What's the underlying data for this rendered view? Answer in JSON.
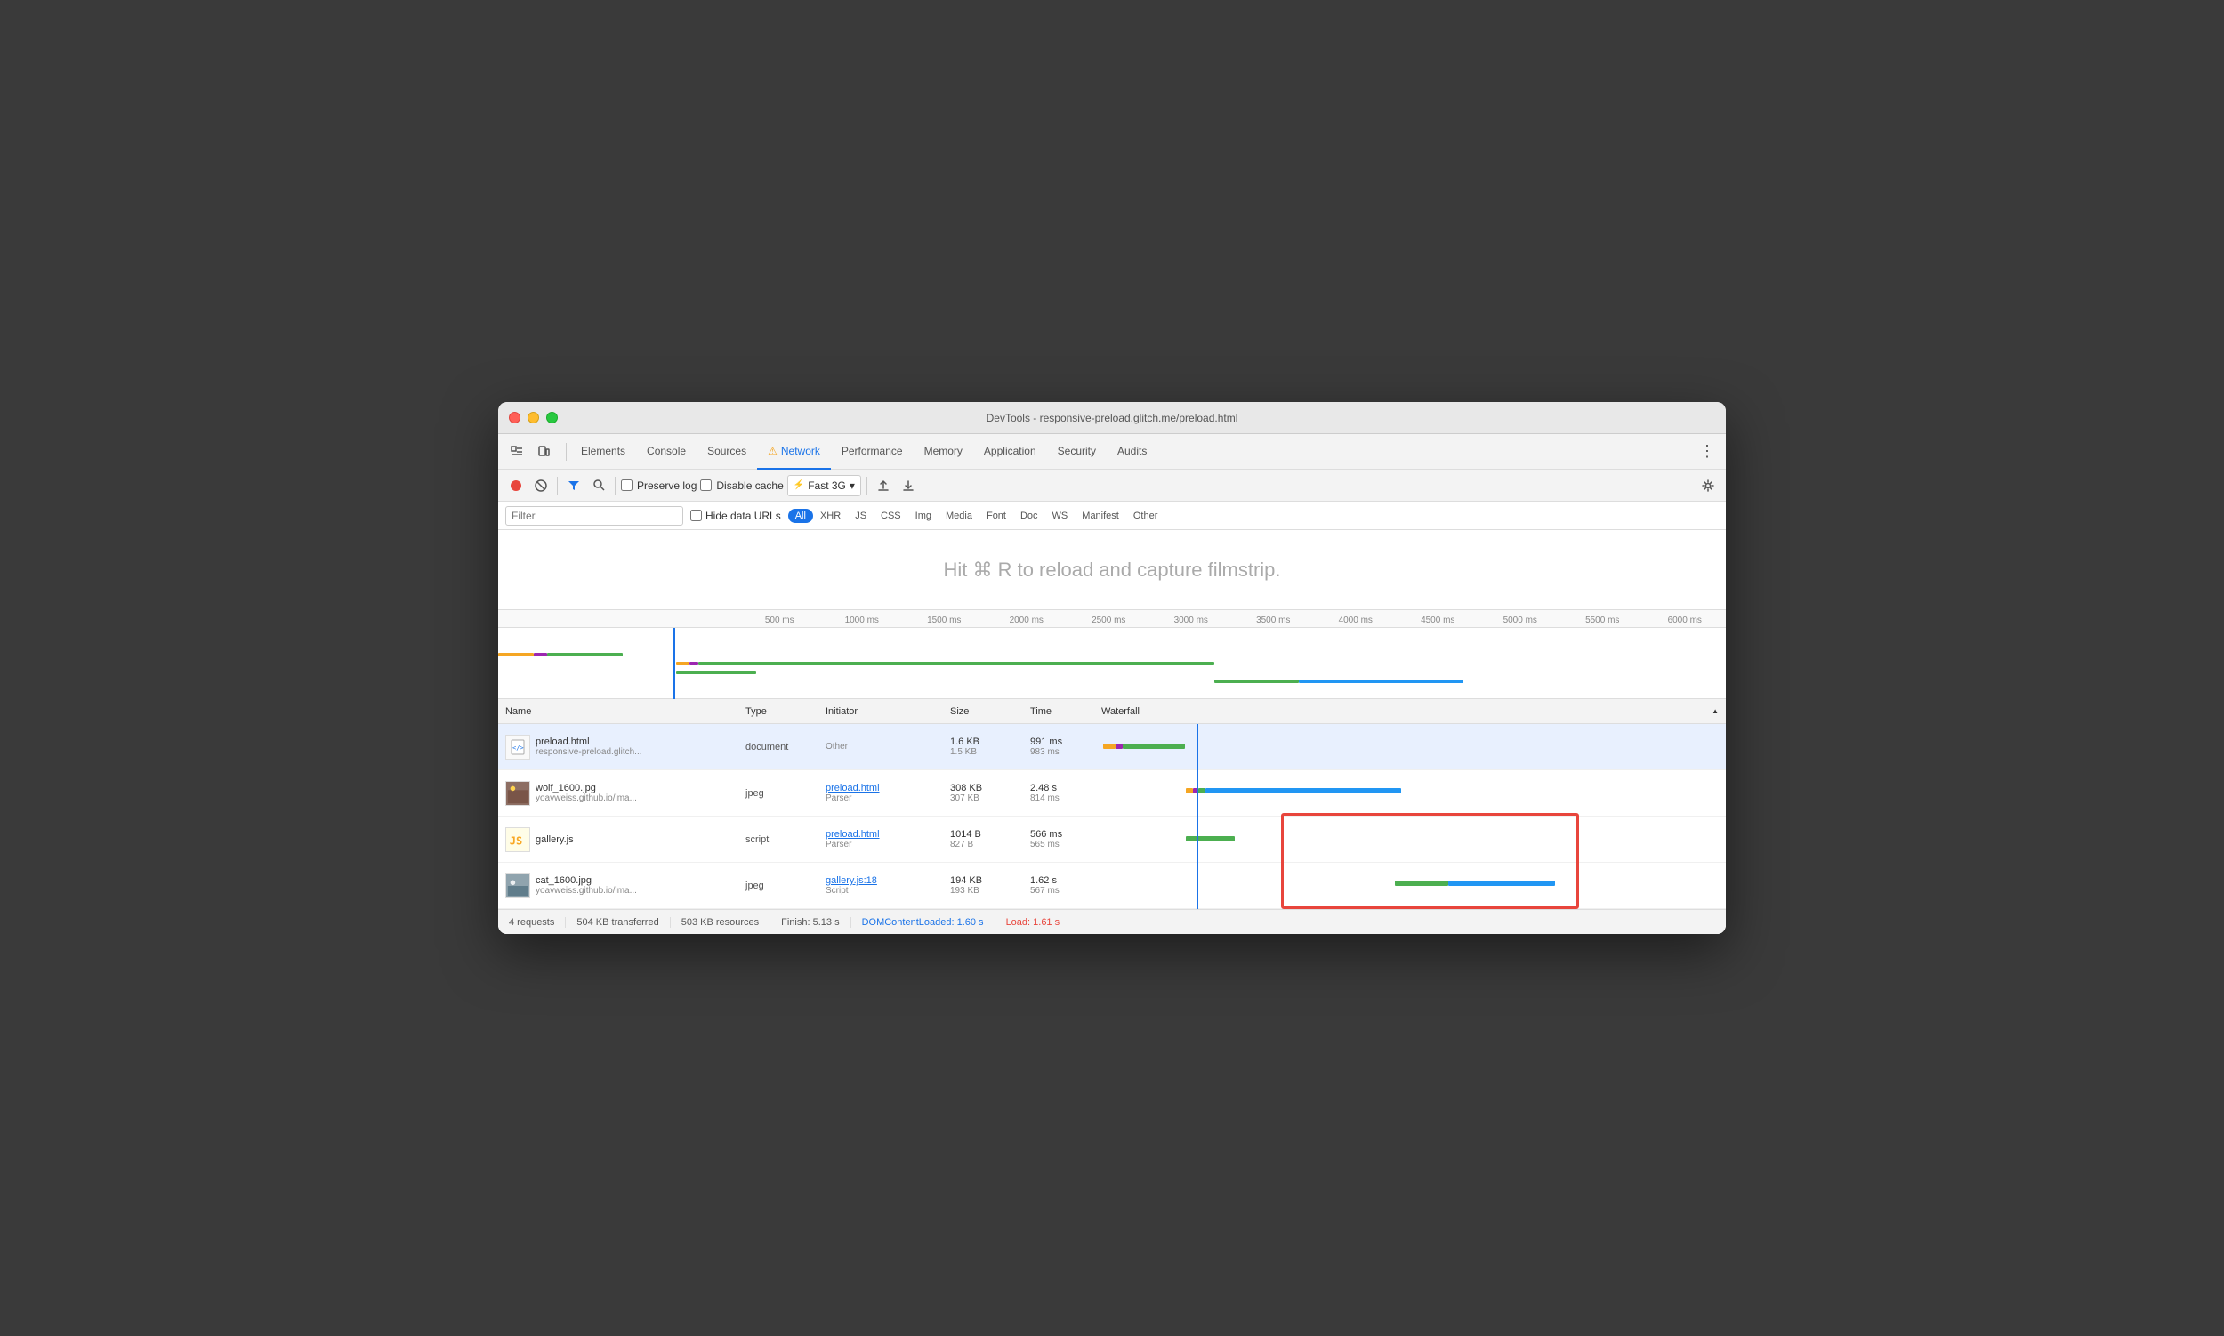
{
  "window": {
    "title": "DevTools - responsive-preload.glitch.me/preload.html"
  },
  "tabs": {
    "items": [
      {
        "label": "Elements",
        "active": false
      },
      {
        "label": "Console",
        "active": false
      },
      {
        "label": "Sources",
        "active": false
      },
      {
        "label": "Network",
        "active": true,
        "warning": true
      },
      {
        "label": "Performance",
        "active": false
      },
      {
        "label": "Memory",
        "active": false
      },
      {
        "label": "Application",
        "active": false
      },
      {
        "label": "Security",
        "active": false
      },
      {
        "label": "Audits",
        "active": false
      }
    ]
  },
  "toolbar": {
    "preserve_log": "Preserve log",
    "disable_cache": "Disable cache",
    "throttle": "Fast 3G"
  },
  "filter": {
    "placeholder": "Filter",
    "hide_data_urls": "Hide data URLs",
    "types": [
      "All",
      "XHR",
      "JS",
      "CSS",
      "Img",
      "Media",
      "Font",
      "Doc",
      "WS",
      "Manifest",
      "Other"
    ]
  },
  "filmstrip": {
    "hint": "Hit ⌘ R to reload and capture filmstrip."
  },
  "ruler": {
    "marks": [
      "500 ms",
      "1000 ms",
      "1500 ms",
      "2000 ms",
      "2500 ms",
      "3000 ms",
      "3500 ms",
      "4000 ms",
      "4500 ms",
      "5000 ms",
      "5500 ms",
      "6000 ms"
    ]
  },
  "table": {
    "headers": {
      "name": "Name",
      "type": "Type",
      "initiator": "Initiator",
      "size": "Size",
      "time": "Time",
      "waterfall": "Waterfall"
    },
    "rows": [
      {
        "filename": "preload.html",
        "url": "responsive-preload.glitch...",
        "type": "document",
        "initiator": "",
        "initiator_sub": "Other",
        "size": "1.6 KB",
        "size_sub": "1.5 KB",
        "time": "991 ms",
        "time_sub": "983 ms",
        "icon_type": "html"
      },
      {
        "filename": "wolf_1600.jpg",
        "url": "yoavweiss.github.io/ima...",
        "type": "jpeg",
        "initiator": "preload.html",
        "initiator_sub": "Parser",
        "size": "308 KB",
        "size_sub": "307 KB",
        "time": "2.48 s",
        "time_sub": "814 ms",
        "icon_type": "jpg"
      },
      {
        "filename": "gallery.js",
        "url": "",
        "type": "script",
        "initiator": "preload.html",
        "initiator_sub": "Parser",
        "size": "1014 B",
        "size_sub": "827 B",
        "time": "566 ms",
        "time_sub": "565 ms",
        "icon_type": "js"
      },
      {
        "filename": "cat_1600.jpg",
        "url": "yoavweiss.github.io/ima...",
        "type": "jpeg",
        "initiator": "gallery.js:18",
        "initiator_sub": "Script",
        "size": "194 KB",
        "size_sub": "193 KB",
        "time": "1.62 s",
        "time_sub": "567 ms",
        "icon_type": "jpg"
      }
    ]
  },
  "status": {
    "requests": "4 requests",
    "transferred": "504 KB transferred",
    "resources": "503 KB resources",
    "finish": "Finish: 5.13 s",
    "dom_content": "DOMContentLoaded: 1.60 s",
    "load": "Load: 1.61 s"
  }
}
